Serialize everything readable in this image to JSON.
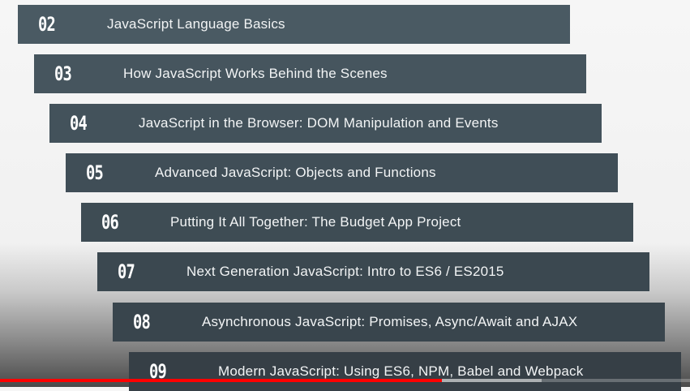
{
  "sections": [
    {
      "number": "02",
      "title": "JavaScript Language Basics"
    },
    {
      "number": "03",
      "title": "How JavaScript Works Behind the Scenes"
    },
    {
      "number": "04",
      "title": "JavaScript in the Browser: DOM Manipulation and Events"
    },
    {
      "number": "05",
      "title": "Advanced JavaScript: Objects and Functions"
    },
    {
      "number": "06",
      "title": "Putting It All Together: The Budget App Project"
    },
    {
      "number": "07",
      "title": "Next Generation JavaScript: Intro to ES6 / ES2015"
    },
    {
      "number": "08",
      "title": "Asynchronous JavaScript: Promises, Async/Await and AJAX"
    },
    {
      "number": "09",
      "title": "Modern JavaScript: Using ES6, NPM, Babel and Webpack"
    }
  ],
  "video_progress": {
    "played_fraction": 0.64,
    "loaded_fraction": 0.785,
    "played_color": "#ff0000"
  }
}
